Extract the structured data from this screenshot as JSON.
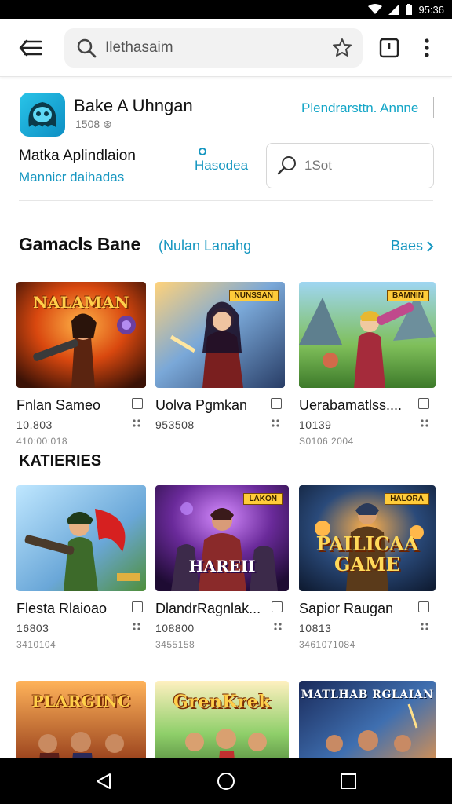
{
  "status": {
    "time": "95:36"
  },
  "toolbar": {
    "search_placeholder": "Ilethasaim"
  },
  "app": {
    "name": "Bake A Uhngan",
    "meta": "1508 ⊛",
    "link": "Plendrarsttn. Annne",
    "description_title": "Matka Aplindlaion",
    "description_sub": "Mannicr daihadas",
    "download_label": "Hasodea",
    "mini_search_text": "1Sot"
  },
  "section": {
    "title": "Gamacls Bane",
    "subtitle": "(Nulan Lanahg",
    "see_all": "Baes"
  },
  "category": {
    "title": "KATIERIES"
  },
  "tiles": [
    {
      "title": "Fnlan Sameo",
      "count": "10.803",
      "date": "410:00:018",
      "caption": "NALAMAN",
      "badge": "",
      "center": ""
    },
    {
      "title": "Uolva Pgmkan",
      "count": "953508",
      "date": "",
      "caption": "",
      "badge": "NUNSSAN",
      "center": ""
    },
    {
      "title": "Uerabamatlss....",
      "count": "10139",
      "date": "S0106 2004",
      "caption": "",
      "badge": "BAMNIN",
      "center": ""
    },
    {
      "title": "Flesta Rlaioao",
      "count": "16803",
      "date": "3410104",
      "caption": "",
      "badge": "",
      "center": ""
    },
    {
      "title": "DlandrRagnlak...",
      "count": "108800",
      "date": "3455158",
      "caption": "",
      "badge": "LAKON",
      "center": "HAREII"
    },
    {
      "title": "Sapior Raugan",
      "count": "10813",
      "date": "3461071084",
      "caption": "",
      "badge": "HALORA",
      "center": "PAILICAA\nGAME"
    },
    {
      "title": "",
      "count": "",
      "date": "",
      "caption": "PLARGINC",
      "badge": "",
      "center": ""
    },
    {
      "title": "",
      "count": "",
      "date": "",
      "caption": "GrenKrek",
      "badge": "",
      "center": ""
    },
    {
      "title": "",
      "count": "",
      "date": "",
      "caption": "MATLHAB RGLAIAN",
      "badge": "",
      "center": ""
    }
  ],
  "colors": {
    "accent": "#1596c0",
    "nav_bg": "#000000"
  }
}
